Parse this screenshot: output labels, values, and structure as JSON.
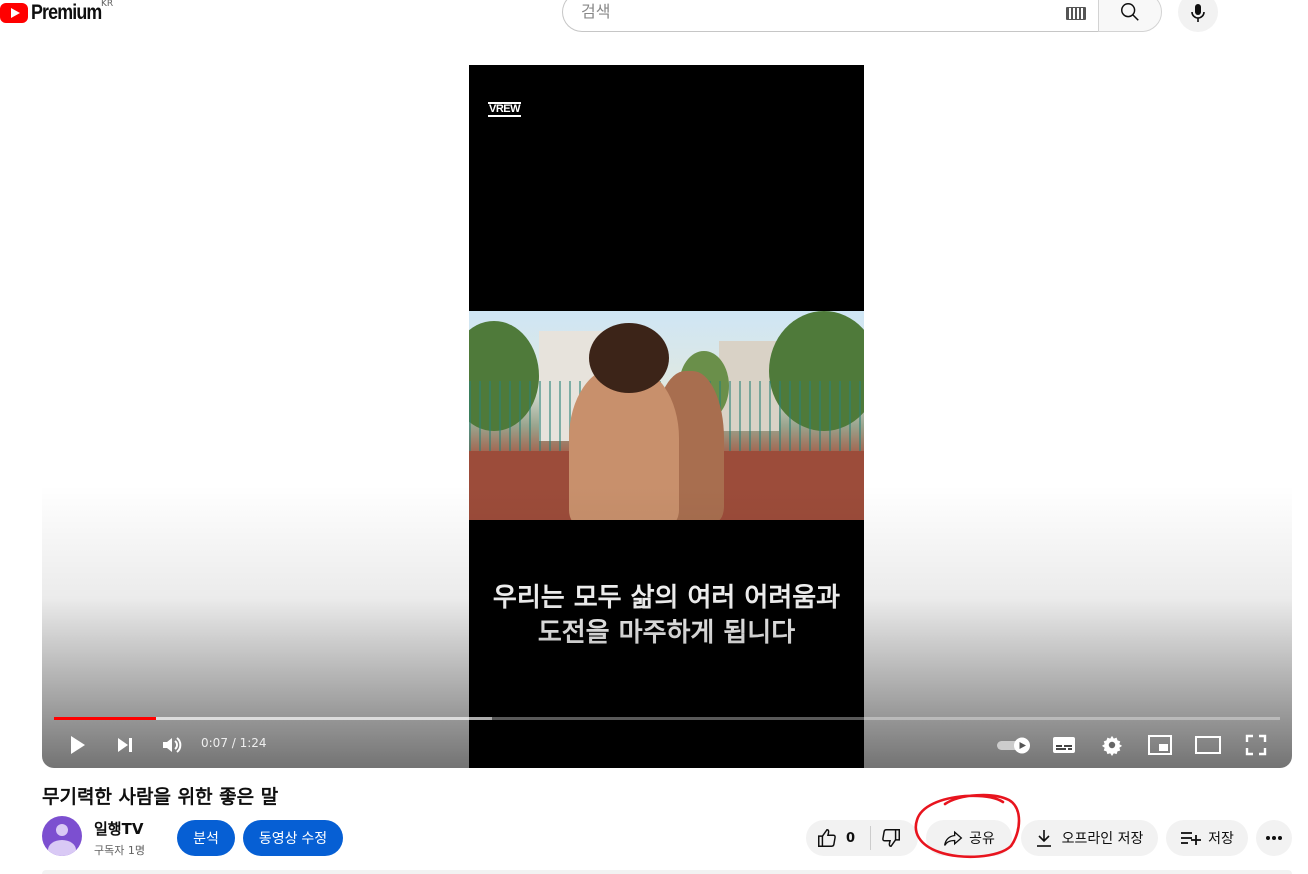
{
  "header": {
    "logo_text": "Premium",
    "country_code": "KR",
    "search_placeholder": "검색"
  },
  "player": {
    "watermark": "VREW",
    "caption_lines": [
      "우리는 모두 삶의 여러 어려움과",
      "도전을 마주하게 됩니다"
    ],
    "current_time": "0:07",
    "duration": "1:24",
    "time_display": "0:07 / 1:24",
    "played_fraction": 0.083,
    "buffered_fraction": 0.357,
    "progress_color": "#ff0000"
  },
  "video": {
    "title": "무기력한 사람을 위한 좋은 말",
    "channel_name": "일행TV",
    "subscribers": "구독자 1명",
    "analytics_label": "분석",
    "edit_label": "동영상 수정",
    "like_count": "0",
    "share_label": "공유",
    "download_label": "오프라인 저장",
    "save_label": "저장"
  },
  "colors": {
    "accent_blue": "#065fd4",
    "annotation_red": "#e8141e"
  }
}
